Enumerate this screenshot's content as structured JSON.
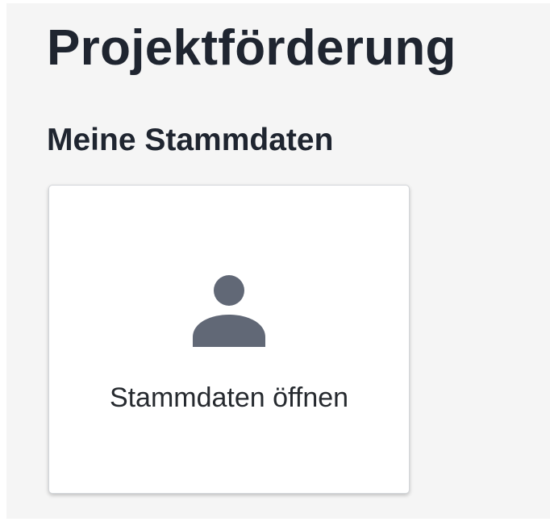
{
  "page": {
    "title": "Projektförderung",
    "section_title": "Meine Stammdaten"
  },
  "card": {
    "label": "Stammdaten öffnen",
    "icon": "person-icon",
    "icon_color": "#616876"
  },
  "colors": {
    "background": "#f5f5f5",
    "text": "#1f2530",
    "card_background": "#ffffff"
  }
}
